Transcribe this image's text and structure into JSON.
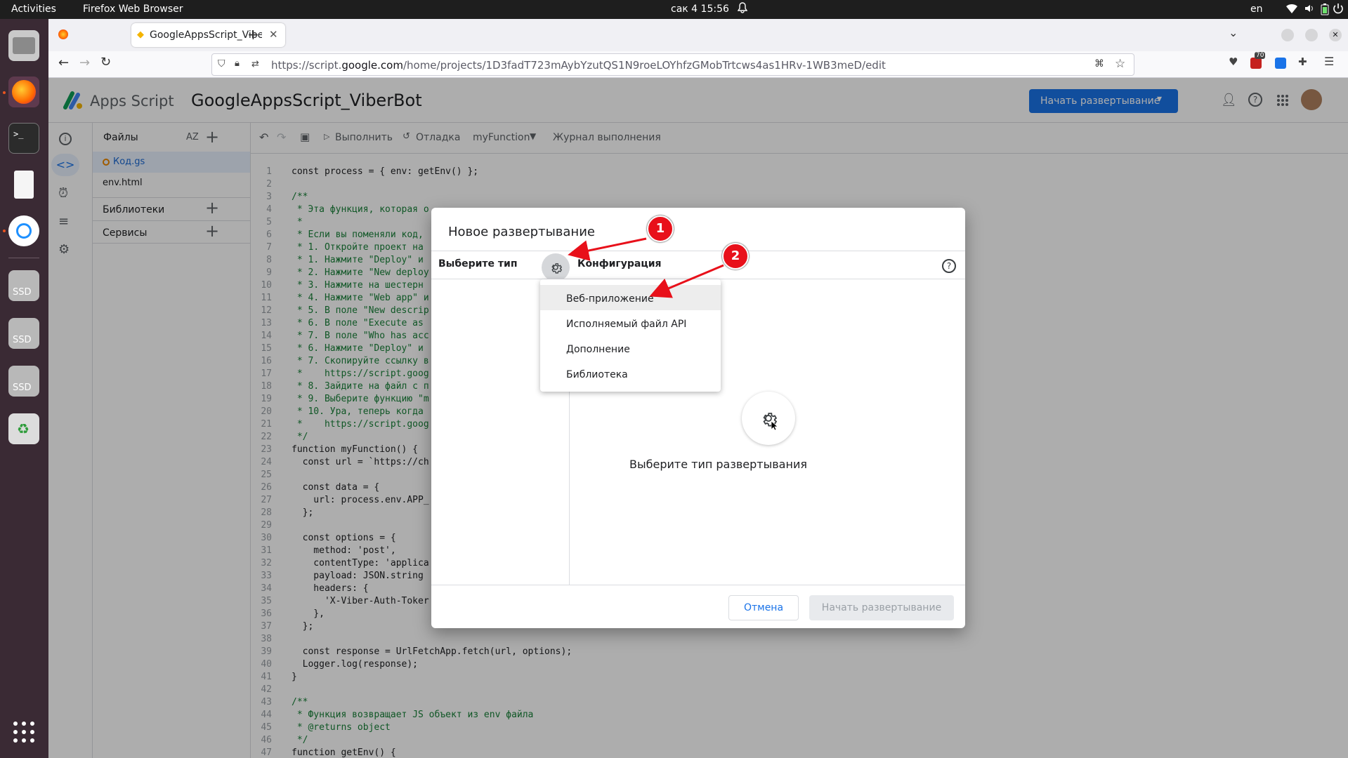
{
  "system": {
    "activities": "Activities",
    "app_name": "Firefox Web Browser",
    "clock": "сак 4  15:56",
    "lang": "en",
    "ssd_labels": [
      "SSD",
      "SSD",
      "SSD"
    ]
  },
  "browser": {
    "tab_title": "GoogleAppsScript_ViberB",
    "url_prefix": "https://script.",
    "url_domain": "google.com",
    "url_rest": "/home/projects/1D3fadT723mAybYzutQS1N9roeLOYhfzGMobTrtcws4as1HRv-1WB3meD/edit",
    "ext_badge": "70"
  },
  "app": {
    "brand": "Apps Script",
    "project_title": "GoogleAppsScript_ViberBot",
    "deploy_button": "Начать развертывание"
  },
  "files_panel": {
    "title": "Файлы",
    "sort_label": "AZ",
    "files": [
      "Код.gs",
      "env.html"
    ],
    "libraries": "Библиотеки",
    "services": "Сервисы"
  },
  "toolbar": {
    "run": "Выполнить",
    "debug": "Отладка",
    "function_name": "myFunction",
    "log": "Журнал выполнения"
  },
  "code_lines": [
    {
      "n": "1",
      "t": "const process = { env: getEnv() };"
    },
    {
      "n": "2",
      "t": ""
    },
    {
      "n": "3",
      "t": "/**"
    },
    {
      "n": "4",
      "t": " * Эта функция, которая о"
    },
    {
      "n": "5",
      "t": " *"
    },
    {
      "n": "6",
      "t": " * Если вы поменяли код,"
    },
    {
      "n": "7",
      "t": " * 1. Откройте проект на"
    },
    {
      "n": "8",
      "t": " * 1. Нажмите \"Deploy\" и"
    },
    {
      "n": "9",
      "t": " * 2. Нажмите \"New deploy"
    },
    {
      "n": "10",
      "t": " * 3. Нажмите на шестерн"
    },
    {
      "n": "11",
      "t": " * 4. Нажмите \"Web app\" и"
    },
    {
      "n": "12",
      "t": " * 5. В поле \"New descrip"
    },
    {
      "n": "13",
      "t": " * 6. В поле \"Execute as"
    },
    {
      "n": "14",
      "t": " * 7. В поле \"Who has acc"
    },
    {
      "n": "15",
      "t": " * 6. Нажмите \"Deploy\" и"
    },
    {
      "n": "16",
      "t": " * 7. Скопируйте ссылку в"
    },
    {
      "n": "17",
      "t": " *    https://script.goog"
    },
    {
      "n": "18",
      "t": " * 8. Зайдите на файл с п"
    },
    {
      "n": "19",
      "t": " * 9. Выберите функцию \"m"
    },
    {
      "n": "20",
      "t": " * 10. Ура, теперь когда"
    },
    {
      "n": "21",
      "t": " *    https://script.goog"
    },
    {
      "n": "22",
      "t": " */"
    },
    {
      "n": "23",
      "t": "function myFunction() {"
    },
    {
      "n": "24",
      "t": "  const url = `https://ch"
    },
    {
      "n": "25",
      "t": ""
    },
    {
      "n": "26",
      "t": "  const data = {"
    },
    {
      "n": "27",
      "t": "    url: process.env.APP_"
    },
    {
      "n": "28",
      "t": "  };"
    },
    {
      "n": "29",
      "t": ""
    },
    {
      "n": "30",
      "t": "  const options = {"
    },
    {
      "n": "31",
      "t": "    method: 'post',"
    },
    {
      "n": "32",
      "t": "    contentType: 'applica"
    },
    {
      "n": "33",
      "t": "    payload: JSON.string"
    },
    {
      "n": "34",
      "t": "    headers: {"
    },
    {
      "n": "35",
      "t": "      'X-Viber-Auth-Toker"
    },
    {
      "n": "36",
      "t": "    },"
    },
    {
      "n": "37",
      "t": "  };"
    },
    {
      "n": "38",
      "t": ""
    },
    {
      "n": "39",
      "t": "  const response = UrlFetchApp.fetch(url, options);"
    },
    {
      "n": "40",
      "t": "  Logger.log(response);"
    },
    {
      "n": "41",
      "t": "}"
    },
    {
      "n": "42",
      "t": ""
    },
    {
      "n": "43",
      "t": "/**"
    },
    {
      "n": "44",
      "t": " * Функция возвращает JS объект из env файла"
    },
    {
      "n": "45",
      "t": " * @returns object"
    },
    {
      "n": "46",
      "t": " */"
    },
    {
      "n": "47",
      "t": "function getEnv() {"
    }
  ],
  "dialog": {
    "title": "Новое развертывание",
    "select_type": "Выберите тип",
    "config": "Конфигурация",
    "placeholder_text": "Выберите тип развертывания",
    "cancel": "Отмена",
    "deploy": "Начать развертывание",
    "menu_items": [
      "Веб-приложение",
      "Исполняемый файл API",
      "Дополнение",
      "Библиотека"
    ]
  },
  "annotations": {
    "marker1": "1",
    "marker2": "2",
    "color": "#e8101a"
  },
  "colors": {
    "primary": "#1a73e8",
    "dock": "#3a2a34"
  }
}
